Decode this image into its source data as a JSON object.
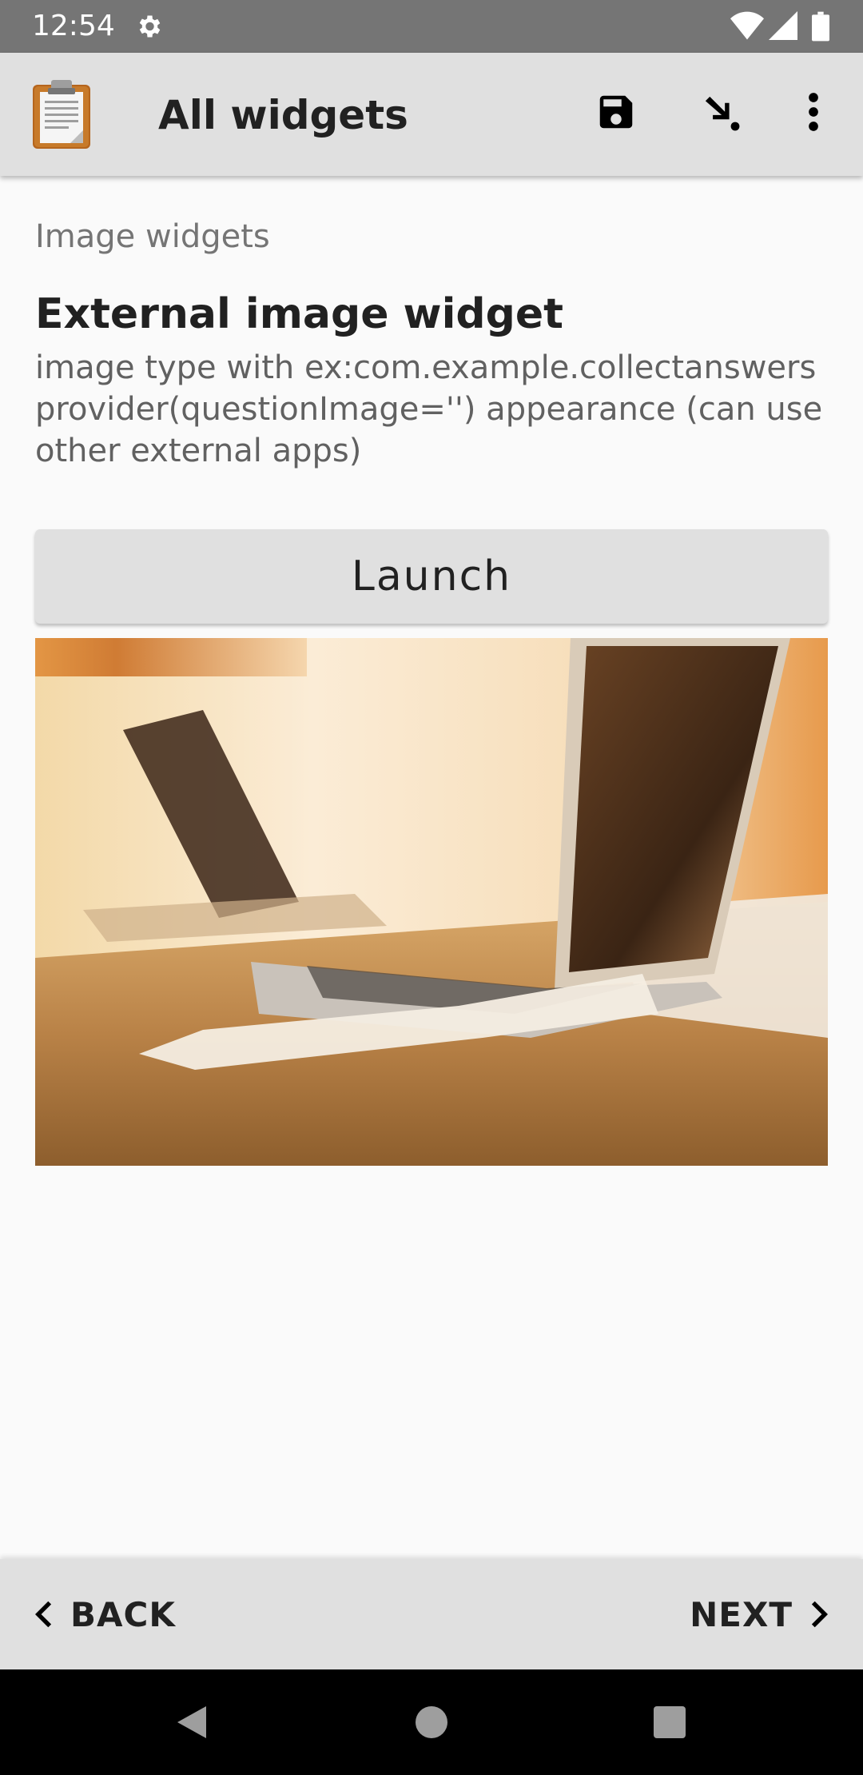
{
  "status_bar": {
    "time": "12:54",
    "icons": [
      "gear-icon",
      "wifi-icon",
      "signal-icon",
      "battery-icon"
    ]
  },
  "app_bar": {
    "title": "All widgets",
    "logo_icon": "clipboard-icon",
    "actions": [
      "save-icon",
      "go-to-arrow-icon",
      "more-vert-icon"
    ],
    "background": "#e0e0e0"
  },
  "form": {
    "group_label": "Image widgets",
    "question": {
      "label": "External image widget",
      "hint": "image type with ex:com.example.collectanswers provider(questionImage='') appearance (can use other external apps)"
    },
    "launch_label": "Launch",
    "answer_image_subject": "laptop on desk photo"
  },
  "bottom_nav": {
    "back_label": "BACK",
    "next_label": "NEXT"
  },
  "system_nav": {
    "icons": [
      "back-triangle-icon",
      "home-circle-icon",
      "recents-square-icon"
    ]
  }
}
